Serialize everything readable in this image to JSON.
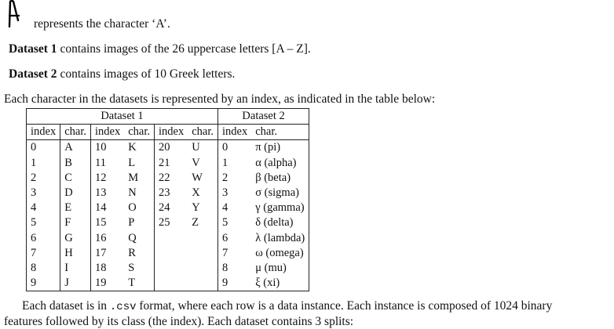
{
  "intro": {
    "glyph_line": "represents the character ‘A’.",
    "d1_label": "Dataset 1",
    "d1_text": "contains images of the 26 uppercase letters [A – Z].",
    "d2_label": "Dataset 2",
    "d2_text": "contains images of 10 Greek letters.",
    "table_intro": "Each character in the datasets is represented by an index, as indicated in the table below:"
  },
  "table": {
    "group1": "Dataset 1",
    "group2": "Dataset 2",
    "col_index": "index",
    "col_char": "char.",
    "d1_cols": [
      [
        [
          "0",
          "A"
        ],
        [
          "1",
          "B"
        ],
        [
          "2",
          "C"
        ],
        [
          "3",
          "D"
        ],
        [
          "4",
          "E"
        ],
        [
          "5",
          "F"
        ],
        [
          "6",
          "G"
        ],
        [
          "7",
          "H"
        ],
        [
          "8",
          "I"
        ],
        [
          "9",
          "J"
        ]
      ],
      [
        [
          "10",
          "K"
        ],
        [
          "11",
          "L"
        ],
        [
          "12",
          "M"
        ],
        [
          "13",
          "N"
        ],
        [
          "14",
          "O"
        ],
        [
          "15",
          "P"
        ],
        [
          "16",
          "Q"
        ],
        [
          "17",
          "R"
        ],
        [
          "18",
          "S"
        ],
        [
          "19",
          "T"
        ]
      ],
      [
        [
          "20",
          "U"
        ],
        [
          "21",
          "V"
        ],
        [
          "22",
          "W"
        ],
        [
          "23",
          "X"
        ],
        [
          "24",
          "Y"
        ],
        [
          "25",
          "Z"
        ],
        [
          "",
          ""
        ],
        [
          "",
          ""
        ],
        [
          "",
          ""
        ],
        [
          "",
          ""
        ]
      ]
    ],
    "d2": [
      [
        "0",
        "π (pi)"
      ],
      [
        "1",
        "α (alpha)"
      ],
      [
        "2",
        "β (beta)"
      ],
      [
        "3",
        "σ (sigma)"
      ],
      [
        "4",
        "γ (gamma)"
      ],
      [
        "5",
        "δ (delta)"
      ],
      [
        "6",
        "λ (lambda)"
      ],
      [
        "7",
        "ω (omega)"
      ],
      [
        "8",
        "μ (mu)"
      ],
      [
        "9",
        "ξ (xi)"
      ]
    ]
  },
  "footer": {
    "p1_pre": "Each dataset is in ",
    "p1_code": ".csv",
    "p1_post": " format, where each row is a data instance. Each instance is composed of 1024 binary",
    "p2": "features followed by its class (the index). Each dataset contains 3 splits:"
  }
}
